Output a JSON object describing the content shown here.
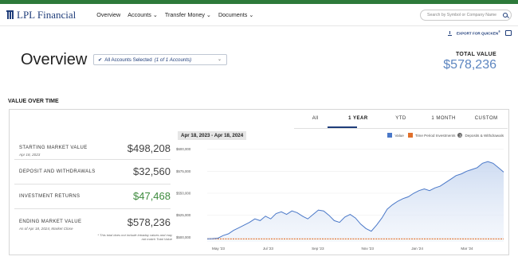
{
  "brand": {
    "name": "LPL Financial"
  },
  "nav": {
    "links": [
      "Overview",
      "Accounts",
      "Transfer Money",
      "Documents"
    ],
    "search_placeholder": "Search by Symbol or Company Name"
  },
  "actions": {
    "export_label": "EXPORT FOR QUICKEN",
    "export_mark": "®"
  },
  "page": {
    "title": "Overview",
    "account_select": "All Accounts Selected",
    "account_select_detail": "(1 of 1 Accounts)",
    "total_value_label": "TOTAL VALUE",
    "total_value": "$578,236"
  },
  "section": {
    "title": "VALUE OVER TIME"
  },
  "tabs": [
    "All",
    "1 YEAR",
    "YTD",
    "1 MONTH",
    "CUSTOM"
  ],
  "active_tab": "1 YEAR",
  "date_range": "Apr 18, 2023 - Apr 18, 2024",
  "legend": {
    "value": "Value",
    "investments": "Time Period Investments",
    "deposits_badge": "3",
    "deposits": "Deposits & Withdrawals"
  },
  "metrics": [
    {
      "label": "STARTING MARKET VALUE",
      "sub": "Apr 18, 2023",
      "value": "$498,208"
    },
    {
      "label": "DEPOSIT AND WITHDRAWALS",
      "sub": "",
      "value": "$32,560"
    },
    {
      "label": "INVESTMENT RETURNS",
      "sub": "",
      "value": "$47,468"
    },
    {
      "label": "ENDING MARKET VALUE",
      "sub": "As of Apr 18, 2024, Market Close",
      "value": "$578,236"
    }
  ],
  "footnote": "* This total does not include intraday values and may not match Total Value",
  "colors": {
    "accent": "#1f3d7a",
    "value_line": "#4a78c8",
    "investments": "#e0702b",
    "returns": "#3e8b3e",
    "topbar": "#2d7a3a"
  },
  "chart_data": {
    "type": "area",
    "x_ticks": [
      "May '23",
      "Jul '23",
      "Sep '23",
      "Nov '23",
      "Jan '24",
      "Mar '24"
    ],
    "y_ticks": [
      "$500,000",
      "$525,000",
      "$550,000",
      "$575,000",
      "$600,000"
    ],
    "ylim": [
      495000,
      605000
    ],
    "series": [
      {
        "name": "Value",
        "values": [
          498208,
          498500,
          499000,
          502000,
          504000,
          508000,
          511000,
          514000,
          517000,
          521000,
          519000,
          524000,
          521000,
          527000,
          529000,
          526000,
          530000,
          528000,
          524000,
          521000,
          526000,
          531000,
          530000,
          525000,
          519000,
          517000,
          523000,
          526000,
          522000,
          515000,
          510000,
          507000,
          514000,
          522000,
          532000,
          537000,
          541000,
          544000,
          546000,
          550000,
          553000,
          555000,
          553000,
          556000,
          558000,
          562000,
          566000,
          570000,
          572000,
          575000,
          577000,
          579000,
          584000,
          586000,
          584000,
          579000,
          574000
        ]
      },
      {
        "name": "Time Period Investments",
        "values": [
          498208,
          498208
        ]
      }
    ]
  }
}
